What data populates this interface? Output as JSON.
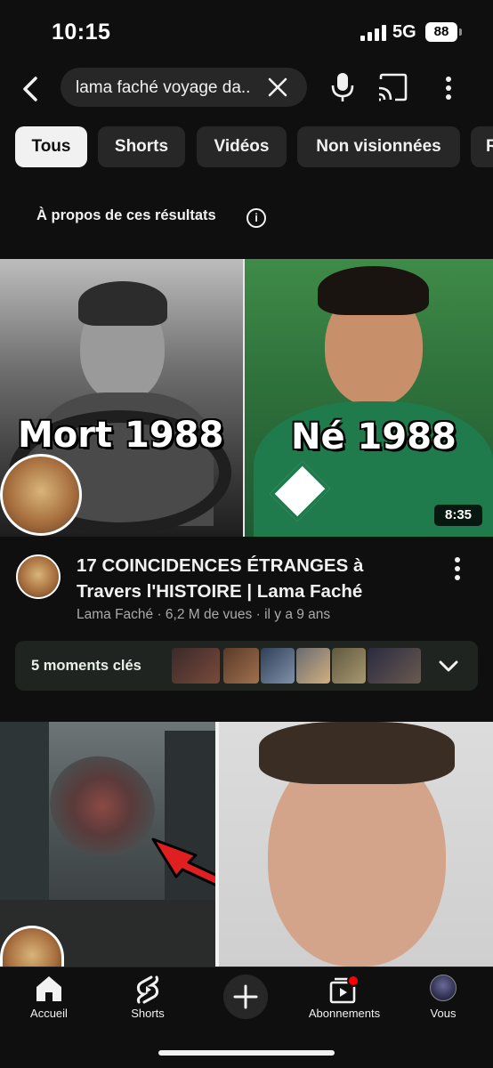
{
  "status_bar": {
    "time": "10:15",
    "network": "5G",
    "battery": "88"
  },
  "search": {
    "query": "lama faché voyage da.."
  },
  "chips": [
    "Tous",
    "Shorts",
    "Vidéos",
    "Non visionnées",
    "R"
  ],
  "about": {
    "label": "À propos de ces résultats"
  },
  "video1": {
    "overlay_left": "Mort 1988",
    "overlay_right": "Né 1988",
    "duration": "8:35",
    "title": "17 COINCIDENCES ÉTRANGES à Travers l'HISTOIRE  | Lama Faché",
    "meta": "Lama Faché · 6,2 M de vues · il y a 9 ans"
  },
  "key_moments": {
    "label": "5 moments clés"
  },
  "bottom_nav": {
    "home": "Accueil",
    "shorts": "Shorts",
    "subscriptions": "Abonnements",
    "you": "Vous"
  },
  "icons": {
    "back": "back-arrow-icon",
    "clear": "close-icon",
    "mic": "microphone-icon",
    "cast": "cast-icon",
    "more": "more-vertical-icon",
    "info": "info-icon",
    "chevron": "chevron-down-icon",
    "home": "home-icon",
    "shorts": "shorts-icon",
    "create": "plus-icon",
    "subscriptions": "subscriptions-icon"
  },
  "colors": {
    "background": "#0f0f0f",
    "chip_bg": "#272727",
    "chip_active": "#f1f1f1",
    "meta_text": "#aaaaaa",
    "notification": "#ff0000"
  }
}
